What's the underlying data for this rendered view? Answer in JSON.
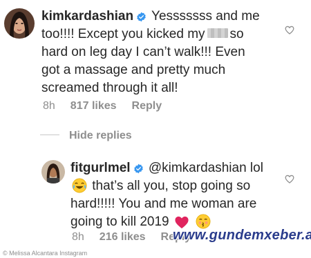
{
  "comments": [
    {
      "username": "kimkardashian",
      "text_line1": "Yesssssss and me",
      "text_line2a": "too!!!! Except you kicked my",
      "text_line2b": "so",
      "text_line3": "hard on leg day I can’t walk!!! Even",
      "text_line4": "got a massage and pretty much",
      "text_line5": "screamed through it all!",
      "time": "8h",
      "likes": "817 likes",
      "reply": "Reply",
      "avatar_icon": "profile-photo-icon",
      "verified_icon": "verified-badge-icon",
      "like_icon": "heart-outline-icon"
    },
    {
      "username": "fitgurlmel",
      "mention": "@kimkardashian",
      "text_line1_end": "lol",
      "text_line2": "that’s all you, stop going so",
      "text_line3": "hard!!!!! You and me woman are",
      "text_line4": "going to kill 2019",
      "time": "8h",
      "likes": "216 likes",
      "reply": "Reply",
      "avatar_icon": "profile-photo-icon",
      "verified_icon": "verified-badge-icon",
      "like_icon": "heart-outline-icon",
      "emojis": [
        "tears-of-joy-emoji",
        "red-heart-emoji",
        "kissing-face-emoji"
      ]
    }
  ],
  "hide_replies": "Hide replies",
  "watermark": "www.gundemxeber.az",
  "credit": "© Melissa Alcantara Instagram",
  "colors": {
    "text": "#262626",
    "meta": "#8e8e8e",
    "verified": "#3897f0",
    "heart_red": "#e0245e",
    "watermark": "#2a3c8c"
  }
}
